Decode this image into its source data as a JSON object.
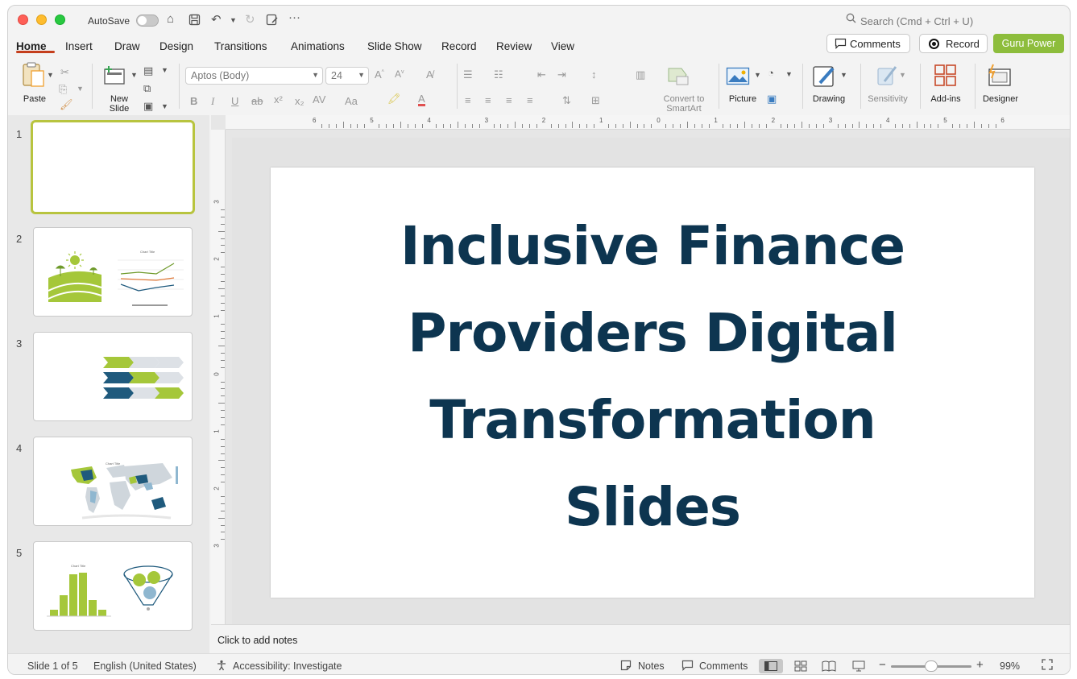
{
  "titlebar": {
    "autosave_label": "AutoSave",
    "autosave_on": false,
    "search_placeholder": "Search (Cmd + Ctrl + U)"
  },
  "tabs": [
    "Home",
    "Insert",
    "Draw",
    "Design",
    "Transitions",
    "Animations",
    "Slide Show",
    "Record",
    "Review",
    "View"
  ],
  "active_tab": "Home",
  "header_buttons": {
    "comments": "Comments",
    "record": "Record",
    "guru": "Guru Power"
  },
  "ribbon": {
    "paste": "Paste",
    "new_slide_1": "New",
    "new_slide_2": "Slide",
    "font_name": "Aptos (Body)",
    "font_size": "24",
    "convert_1": "Convert to",
    "convert_2": "SmartArt",
    "picture": "Picture",
    "drawing": "Drawing",
    "sensitivity": "Sensitivity",
    "addins": "Add-ins",
    "designer": "Designer"
  },
  "thumbnails": [
    {
      "number": "1",
      "selected": true
    },
    {
      "number": "2",
      "chart_title": "Chart Title"
    },
    {
      "number": "3"
    },
    {
      "number": "4",
      "chart_title": "Chart Title"
    },
    {
      "number": "5",
      "chart_title": "Chart Title"
    }
  ],
  "ruler": {
    "h_labels": [
      "6",
      "5",
      "4",
      "3",
      "2",
      "1",
      "0",
      "1",
      "2",
      "3",
      "4",
      "5",
      "6"
    ],
    "v_labels": [
      "3",
      "2",
      "1",
      "0",
      "1",
      "2",
      "3"
    ]
  },
  "slide": {
    "title": "Inclusive Finance Providers Digital Transformation Slides"
  },
  "notes_placeholder": "Click to add notes",
  "statusbar": {
    "slide_counter": "Slide 1 of 5",
    "language": "English (United States)",
    "accessibility": "Accessibility: Investigate",
    "notes": "Notes",
    "comments": "Comments",
    "zoom": "99%"
  },
  "colors": {
    "accent_tab": "#c43e1c",
    "guru_green": "#8dbd3c",
    "title_navy": "#0d3550",
    "lime": "#a5c73a",
    "teal": "#1f5a7d"
  }
}
